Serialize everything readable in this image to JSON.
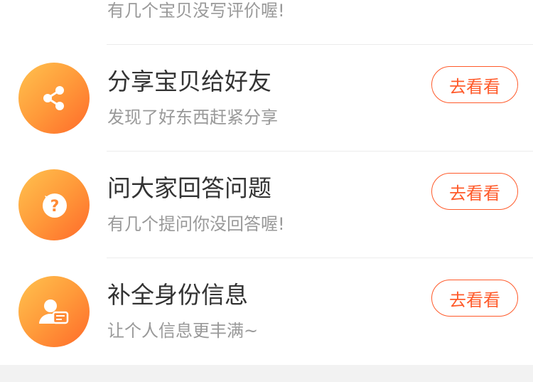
{
  "tasks": [
    {
      "subtitle": "有几个宝贝没写评价喔!"
    },
    {
      "title": "分享宝贝给好友",
      "subtitle": "发现了好东西赶紧分享",
      "button": "去看看",
      "icon": "share-icon"
    },
    {
      "title": "问大家回答问题",
      "subtitle": "有几个提问你没回答喔!",
      "button": "去看看",
      "icon": "question-bubble-icon"
    },
    {
      "title": "补全身份信息",
      "subtitle": "让个人信息更丰满~",
      "button": "去看看",
      "icon": "user-card-icon"
    }
  ],
  "colors": {
    "accent": "#ff5a2a",
    "icon_gradient_start": "#ffc24f",
    "icon_gradient_end": "#ff6a2a",
    "title": "#333333",
    "subtitle": "#999999",
    "divider": "#ececec",
    "footer": "#f2f2f2"
  }
}
